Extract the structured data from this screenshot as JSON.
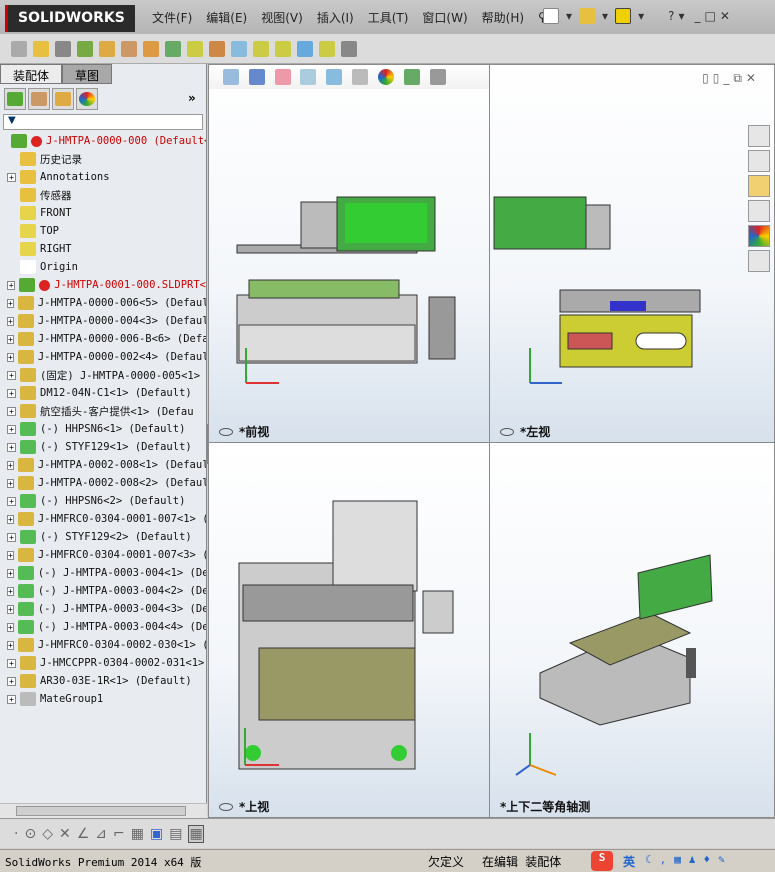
{
  "app": {
    "logo": "SOLIDWORKS"
  },
  "menu": [
    "文件(F)",
    "编辑(E)",
    "视图(V)",
    "插入(I)",
    "工具(T)",
    "窗口(W)",
    "帮助(H)"
  ],
  "panel": {
    "tabs": [
      "装配体",
      "草图"
    ],
    "expand_label": "»"
  },
  "tree": [
    {
      "label": "J-HMTPA-0000-000   (Default<",
      "error": true,
      "exp": false,
      "icon": "assembly-root"
    },
    {
      "label": "历史记录",
      "exp": false,
      "icon": "history"
    },
    {
      "label": "Annotations",
      "exp": true,
      "icon": "annotations"
    },
    {
      "label": "传感器",
      "exp": false,
      "icon": "sensors"
    },
    {
      "label": "FRONT",
      "exp": false,
      "icon": "plane"
    },
    {
      "label": "TOP",
      "exp": false,
      "icon": "plane"
    },
    {
      "label": "RIGHT",
      "exp": false,
      "icon": "plane"
    },
    {
      "label": "Origin",
      "exp": false,
      "icon": "origin"
    },
    {
      "label": "J-HMTPA-0001-000.SLDPRT<",
      "error": true,
      "exp": true,
      "icon": "subassembly"
    },
    {
      "label": "J-HMTPA-0000-006<5> (Defaul",
      "exp": true,
      "icon": "part"
    },
    {
      "label": "J-HMTPA-0000-004<3> (Defaul",
      "exp": true,
      "icon": "part"
    },
    {
      "label": "J-HMTPA-0000-006-B<6> (Defa",
      "exp": true,
      "icon": "part"
    },
    {
      "label": "J-HMTPA-0000-002<4> (Defaul",
      "exp": true,
      "icon": "part"
    },
    {
      "label": "(固定) J-HMTPA-0000-005<1>",
      "exp": true,
      "icon": "part"
    },
    {
      "label": "DM12-04N-C1<1> (Default)",
      "exp": true,
      "icon": "part"
    },
    {
      "label": "航空插头-客户提供<1> (Defau",
      "exp": true,
      "icon": "part"
    },
    {
      "label": "(-) HHPSN6<1> (Default)",
      "exp": true,
      "icon": "part-green"
    },
    {
      "label": "(-) STYF129<1> (Default)",
      "exp": true,
      "icon": "part-green"
    },
    {
      "label": "J-HMTPA-0002-008<1> (Defaul",
      "exp": true,
      "icon": "part"
    },
    {
      "label": "J-HMTPA-0002-008<2> (Defaul",
      "exp": true,
      "icon": "part"
    },
    {
      "label": "(-) HHPSN6<2> (Default)",
      "exp": true,
      "icon": "part-green"
    },
    {
      "label": "J-HMFRC0-0304-0001-007<1> (",
      "exp": true,
      "icon": "part"
    },
    {
      "label": "(-) STYF129<2> (Default)",
      "exp": true,
      "icon": "part-green"
    },
    {
      "label": "J-HMFRC0-0304-0001-007<3> (",
      "exp": true,
      "icon": "part"
    },
    {
      "label": "(-) J-HMTPA-0003-004<1> (De",
      "exp": true,
      "icon": "part-green"
    },
    {
      "label": "(-) J-HMTPA-0003-004<2> (De",
      "exp": true,
      "icon": "part-green"
    },
    {
      "label": "(-) J-HMTPA-0003-004<3> (De",
      "exp": true,
      "icon": "part-green"
    },
    {
      "label": "(-) J-HMTPA-0003-004<4> (De",
      "exp": true,
      "icon": "part-green"
    },
    {
      "label": "J-HMFRC0-0304-0002-030<1> (",
      "exp": true,
      "icon": "part"
    },
    {
      "label": "J-HMCCPPR-0304-0002-031<1>",
      "exp": true,
      "icon": "part"
    },
    {
      "label": "AR30-03E-1R<1> (Default)",
      "exp": true,
      "icon": "part"
    },
    {
      "label": "MateGroup1",
      "exp": true,
      "icon": "mates"
    }
  ],
  "views": {
    "front": "*前视",
    "left": "*左视",
    "top": "*上视",
    "iso": "*上下二等角轴测"
  },
  "status": {
    "product": "SolidWorks Premium 2014 x64 版",
    "state": "欠定义",
    "mode": "在编辑 装配体",
    "ime": "英"
  },
  "colors": {
    "error": "#cc0000",
    "viewport_bg": "#f3f6fa",
    "title": "#b4b4b4"
  }
}
